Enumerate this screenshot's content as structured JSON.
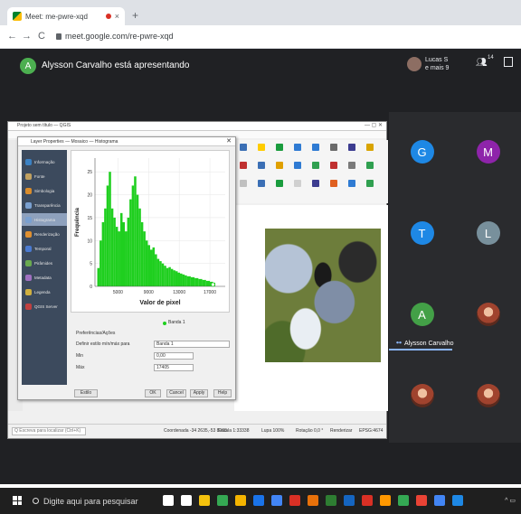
{
  "browser": {
    "tab_title": "Meet: me-pwre-xqd",
    "tab_close": "×",
    "new_tab": "+",
    "back": "←",
    "forward": "→",
    "reload": "C",
    "url": "meet.google.com/re-pwre-xqd"
  },
  "meet": {
    "presenter_initial": "A",
    "presenter_text": "Alysson Carvalho está apresentando",
    "people_label_1": "Lucas S",
    "people_label_2": "e mais 9",
    "participants_count": "14",
    "participants": [
      {
        "initial": "G",
        "color": "#1e88e5",
        "name": ""
      },
      {
        "initial": "M",
        "color": "#8e24aa",
        "name": ""
      },
      {
        "initial": "T",
        "color": "#1e88e5",
        "name": ""
      },
      {
        "initial": "L",
        "color": "#78909c",
        "name": ""
      },
      {
        "initial": "A",
        "color": "#43a047",
        "name": "Alysson Carvalho"
      },
      {
        "initial": "",
        "color": "",
        "name": ""
      },
      {
        "initial": "",
        "color": "",
        "name": ""
      },
      {
        "initial": "",
        "color": "",
        "name": ""
      }
    ]
  },
  "qgis": {
    "window_title": "Projeto sem título — QGIS",
    "dialog_title": "Layer Properties — Mosaico — Histograma",
    "sidebar": [
      {
        "label": "Informação",
        "color": "#3b82c4"
      },
      {
        "label": "Fonte",
        "color": "#c0a060"
      },
      {
        "label": "Simbologia",
        "color": "#d98c2b"
      },
      {
        "label": "Transparência",
        "color": "#7aa0d0"
      },
      {
        "label": "Histograma",
        "color": "#7aa0d0"
      },
      {
        "label": "Renderização",
        "color": "#e09030"
      },
      {
        "label": "Temporal",
        "color": "#4a7ad0"
      },
      {
        "label": "Pirâmides",
        "color": "#6aaa50"
      },
      {
        "label": "Metadata",
        "color": "#a070c0"
      },
      {
        "label": "Legenda",
        "color": "#d0b040"
      },
      {
        "label": "QGIS Server",
        "color": "#c04040"
      }
    ],
    "histogram_xlabel": "Valor de pixel",
    "histogram_ylabel": "Frequência",
    "legend_label": "Banda 1",
    "prefs_label": "Preferências/Ações",
    "setting_label": "Definir estilo mín/máx para",
    "setting_value": "Banda 1",
    "min_label": "Min",
    "min_value": "0,00",
    "max_label": "Máx",
    "max_value": "17405",
    "style_btn": "Estilo",
    "ok_btn": "OK",
    "cancel_btn": "Cancel",
    "apply_btn": "Apply",
    "help_btn": "Help",
    "search_placeholder": "Q Escreva para localizar (Ctrl+K)",
    "status_coord": "Coordenada -34 2635,-53 8968",
    "status_scale": "Escala 1:33338",
    "status_lupa": "Lupa 100%",
    "status_rot": "Rotação 0,0 °",
    "status_render": "Renderizar",
    "status_epsg": "EPSG:4674"
  },
  "chart_data": {
    "type": "area",
    "title": "",
    "xlabel": "Valor de pixel",
    "ylabel": "Frequência",
    "xticks": [
      "5000",
      "9000",
      "13000",
      "17000"
    ],
    "yticks": [
      "0",
      "5",
      "10",
      "15",
      "20",
      "25"
    ],
    "xlim": [
      2000,
      19000
    ],
    "ylim": [
      0,
      28
    ],
    "series": [
      {
        "name": "Banda 1",
        "color": "#1fcf1f",
        "x": [
          2300,
          2600,
          2900,
          3200,
          3500,
          3800,
          4100,
          4400,
          4700,
          5000,
          5300,
          5600,
          5900,
          6200,
          6500,
          6800,
          7100,
          7400,
          7700,
          8000,
          8300,
          8600,
          8900,
          9200,
          9500,
          9800,
          10100,
          10400,
          10700,
          11000,
          11300,
          11600,
          11900,
          12200,
          12500,
          12800,
          13100,
          13400,
          13700,
          14000,
          14500,
          15000,
          15500,
          16000,
          16500,
          17000,
          17400
        ],
        "y": [
          4,
          10,
          14,
          17,
          22,
          25,
          17,
          15,
          13,
          12,
          16,
          14,
          12,
          15,
          19,
          22,
          24,
          20,
          17,
          14,
          12,
          10,
          9,
          8,
          8.5,
          7,
          6,
          5.5,
          5,
          4.5,
          4,
          4.2,
          3.8,
          3.5,
          3.3,
          3,
          2.8,
          2.6,
          2.4,
          2.2,
          2,
          1.8,
          1.6,
          1.4,
          1.2,
          1,
          0.8
        ]
      }
    ]
  },
  "taskbar": {
    "search_placeholder": "Digite aqui para pesquisar",
    "apps": [
      "#ffffff",
      "#ffffff",
      "#f4c20d",
      "#35a853",
      "#f4b400",
      "#1a73e8",
      "#4285f4",
      "#d93025",
      "#e8710a",
      "#2e7d32",
      "#1565c0",
      "#d93025",
      "#ff9800",
      "#34a853",
      "#ea4335",
      "#4285f4",
      "#1e88e5"
    ],
    "tray": "^ ▭"
  }
}
